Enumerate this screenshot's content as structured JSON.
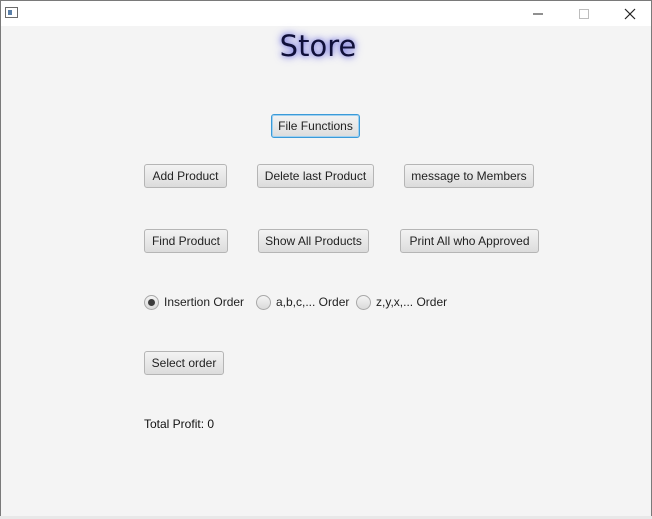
{
  "window": {
    "title": "",
    "controls": {
      "minimize_icon": "minimize-icon",
      "maximize_icon": "maximize-icon",
      "close_icon": "close-icon"
    }
  },
  "header": {
    "title": "Store"
  },
  "buttons": {
    "file_functions": "File Functions",
    "add_product": "Add Product",
    "delete_last_product": "Delete last Product",
    "message_to_members": "message to Members",
    "find_product": "Find Product",
    "show_all_products": "Show All Products",
    "print_all_approved": "Print All who Approved",
    "select_order": "Select order"
  },
  "order_options": [
    {
      "label": "Insertion Order",
      "selected": true
    },
    {
      "label": "a,b,c,... Order",
      "selected": false
    },
    {
      "label": "z,y,x,... Order",
      "selected": false
    }
  ],
  "footer": {
    "total_profit": "Total Profit: 0"
  }
}
